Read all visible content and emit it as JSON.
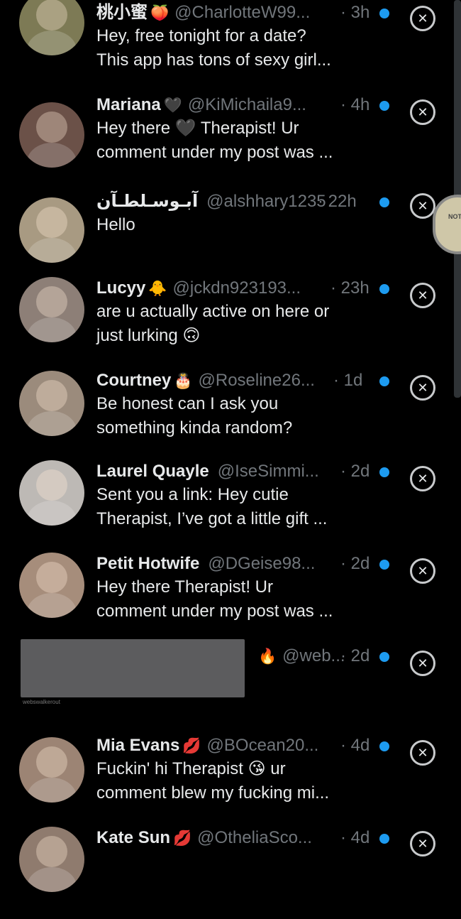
{
  "rows": [
    {
      "name": "桃小蜜",
      "emoji": "🍑",
      "handle": "@CharlotteW99...",
      "time": "· 3h",
      "line1": "Hey, free tonight for a date?",
      "line2": "This app has tons of sexy girl...",
      "avatar_color": "#7d7a55"
    },
    {
      "name": "Mariana",
      "emoji": "🖤",
      "handle": "@KiMichaila9...",
      "time": "· 4h",
      "line1": "Hey there 🖤 Therapist!  Ur",
      "line2": "comment under my post was ...",
      "avatar_color": "#6b5148"
    },
    {
      "name": "آبـوسـلطـآن",
      "emoji": "",
      "handle": "@alshhary1235",
      "time": "· 22h",
      "line1": "Hello",
      "line2": "",
      "avatar_color": "#a89a82"
    },
    {
      "name": "Lucyy",
      "emoji": "🐥",
      "handle": "@jckdn923193...",
      "time": "· 23h",
      "line1": "are u actually active on here or",
      "line2": "just lurking 🙃",
      "avatar_color": "#8d7f77"
    },
    {
      "name": "Courtney",
      "emoji": "🎂",
      "handle": "@Roseline26...",
      "time": "· 1d",
      "line1": "Be honest can I ask you",
      "line2": "something kinda random?",
      "avatar_color": "#9b8b7c"
    },
    {
      "name": "Laurel Quayle",
      "emoji": "",
      "handle": "@IseSimmi...",
      "time": "· 2d",
      "line1": "Sent you a link: Hey cutie",
      "line2": "Therapist, I’ve got a little gift ...",
      "avatar_color": "#bdb9b5"
    },
    {
      "name": "Petit Hotwife",
      "emoji": "",
      "handle": "@DGeise98...",
      "time": "· 2d",
      "line1": "Hey there Therapist!  Ur",
      "line2": "comment under my post was ...",
      "avatar_color": "#a68d7b"
    },
    {
      "name": "",
      "emoji": "🔥",
      "handle": "@web...",
      "time": "· 2d",
      "line1": "",
      "line2": "",
      "avatar_color": "#000000"
    },
    {
      "name": "Mia Evans",
      "emoji": "💋",
      "handle": "@BOcean20...",
      "time": "· 4d",
      "line1": "Fuckin' hi Therapist 😘   ur",
      "line2": "comment blew my fucking mi...",
      "avatar_color": "#9c8474"
    },
    {
      "name": "Kate Sun",
      "emoji": "💋",
      "handle": "@OtheliaSco...",
      "time": "· 4d",
      "line1": "",
      "line2": "",
      "avatar_color": "#8f7b6e"
    }
  ],
  "icons": {
    "close": "close-circle-icon",
    "unread": "unread-dot-icon"
  },
  "colors": {
    "background": "#000000",
    "accent": "#1d9bf0",
    "muted": "#71767b",
    "text": "#e7e9ea"
  },
  "note_bubble": {
    "label": "NOTE"
  },
  "redacted_caption": "webswalkerout"
}
